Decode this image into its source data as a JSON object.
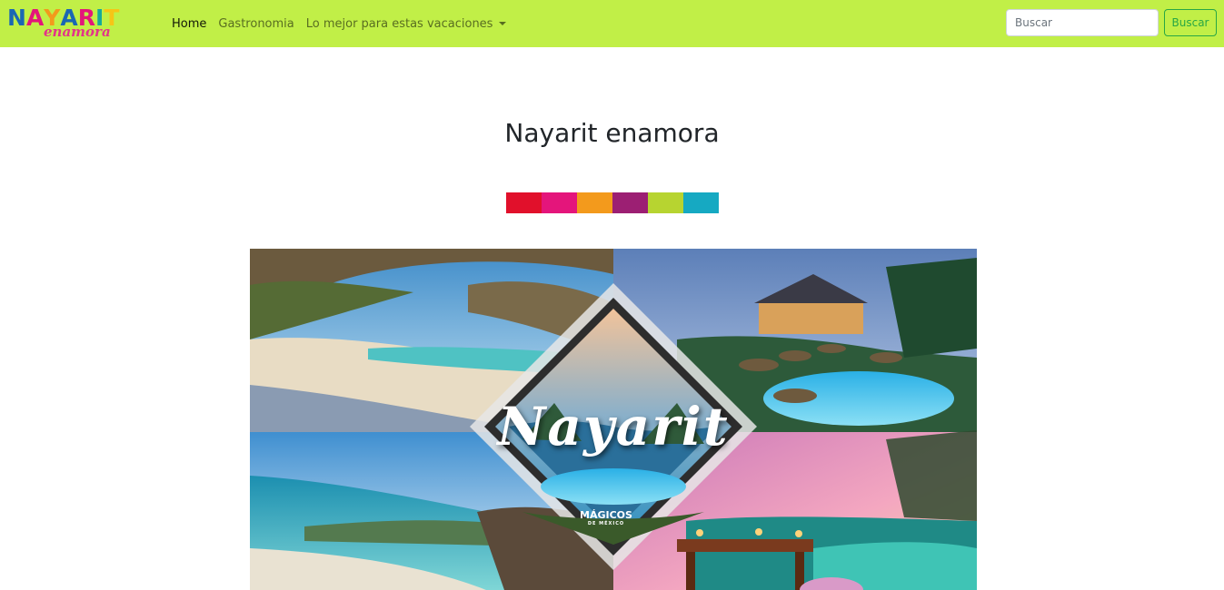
{
  "navbar": {
    "brand_word": "NAYARIT",
    "brand_sub": "enamora",
    "brand_letter_colors": [
      "#1b67b3",
      "#e4157b",
      "#f39a1c",
      "#1b67b3",
      "#e4157b",
      "#16a99a",
      "#f6c516"
    ],
    "links": [
      {
        "label": "Home",
        "active": true
      },
      {
        "label": "Gastronomia",
        "active": false
      },
      {
        "label": "Lo mejor para estas vacaciones",
        "active": false,
        "dropdown": true
      }
    ],
    "search": {
      "placeholder": "Buscar",
      "button_label": "Buscar"
    },
    "background": "#c1ef47"
  },
  "main": {
    "title": "Nayarit enamora",
    "strip_colors": [
      "#e1102b",
      "#e4157b",
      "#f39a1c",
      "#9c1f73",
      "#b7d430",
      "#16a9c2"
    ],
    "hero": {
      "title": "Nayarit",
      "badge": "MÁGICOS",
      "badge_sub": "DE MÉXICO"
    }
  }
}
